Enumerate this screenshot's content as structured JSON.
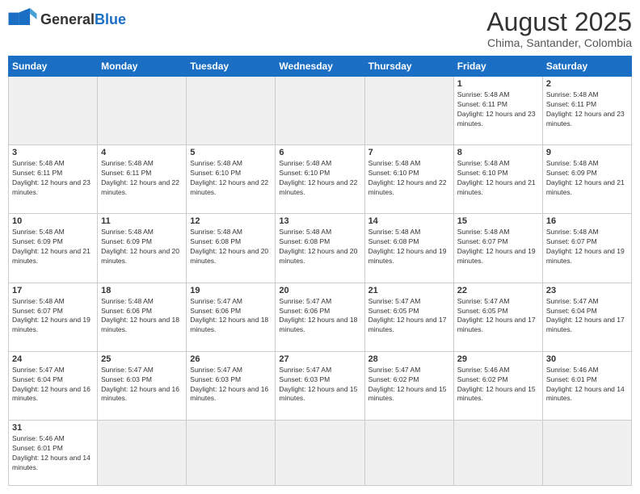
{
  "header": {
    "logo_general": "General",
    "logo_blue": "Blue",
    "month_title": "August 2025",
    "location": "Chima, Santander, Colombia"
  },
  "weekdays": [
    "Sunday",
    "Monday",
    "Tuesday",
    "Wednesday",
    "Thursday",
    "Friday",
    "Saturday"
  ],
  "weeks": [
    [
      {
        "day": "",
        "info": ""
      },
      {
        "day": "",
        "info": ""
      },
      {
        "day": "",
        "info": ""
      },
      {
        "day": "",
        "info": ""
      },
      {
        "day": "",
        "info": ""
      },
      {
        "day": "1",
        "info": "Sunrise: 5:48 AM\nSunset: 6:11 PM\nDaylight: 12 hours and 23 minutes."
      },
      {
        "day": "2",
        "info": "Sunrise: 5:48 AM\nSunset: 6:11 PM\nDaylight: 12 hours and 23 minutes."
      }
    ],
    [
      {
        "day": "3",
        "info": "Sunrise: 5:48 AM\nSunset: 6:11 PM\nDaylight: 12 hours and 23 minutes."
      },
      {
        "day": "4",
        "info": "Sunrise: 5:48 AM\nSunset: 6:11 PM\nDaylight: 12 hours and 22 minutes."
      },
      {
        "day": "5",
        "info": "Sunrise: 5:48 AM\nSunset: 6:10 PM\nDaylight: 12 hours and 22 minutes."
      },
      {
        "day": "6",
        "info": "Sunrise: 5:48 AM\nSunset: 6:10 PM\nDaylight: 12 hours and 22 minutes."
      },
      {
        "day": "7",
        "info": "Sunrise: 5:48 AM\nSunset: 6:10 PM\nDaylight: 12 hours and 22 minutes."
      },
      {
        "day": "8",
        "info": "Sunrise: 5:48 AM\nSunset: 6:10 PM\nDaylight: 12 hours and 21 minutes."
      },
      {
        "day": "9",
        "info": "Sunrise: 5:48 AM\nSunset: 6:09 PM\nDaylight: 12 hours and 21 minutes."
      }
    ],
    [
      {
        "day": "10",
        "info": "Sunrise: 5:48 AM\nSunset: 6:09 PM\nDaylight: 12 hours and 21 minutes."
      },
      {
        "day": "11",
        "info": "Sunrise: 5:48 AM\nSunset: 6:09 PM\nDaylight: 12 hours and 20 minutes."
      },
      {
        "day": "12",
        "info": "Sunrise: 5:48 AM\nSunset: 6:08 PM\nDaylight: 12 hours and 20 minutes."
      },
      {
        "day": "13",
        "info": "Sunrise: 5:48 AM\nSunset: 6:08 PM\nDaylight: 12 hours and 20 minutes."
      },
      {
        "day": "14",
        "info": "Sunrise: 5:48 AM\nSunset: 6:08 PM\nDaylight: 12 hours and 19 minutes."
      },
      {
        "day": "15",
        "info": "Sunrise: 5:48 AM\nSunset: 6:07 PM\nDaylight: 12 hours and 19 minutes."
      },
      {
        "day": "16",
        "info": "Sunrise: 5:48 AM\nSunset: 6:07 PM\nDaylight: 12 hours and 19 minutes."
      }
    ],
    [
      {
        "day": "17",
        "info": "Sunrise: 5:48 AM\nSunset: 6:07 PM\nDaylight: 12 hours and 19 minutes."
      },
      {
        "day": "18",
        "info": "Sunrise: 5:48 AM\nSunset: 6:06 PM\nDaylight: 12 hours and 18 minutes."
      },
      {
        "day": "19",
        "info": "Sunrise: 5:47 AM\nSunset: 6:06 PM\nDaylight: 12 hours and 18 minutes."
      },
      {
        "day": "20",
        "info": "Sunrise: 5:47 AM\nSunset: 6:06 PM\nDaylight: 12 hours and 18 minutes."
      },
      {
        "day": "21",
        "info": "Sunrise: 5:47 AM\nSunset: 6:05 PM\nDaylight: 12 hours and 17 minutes."
      },
      {
        "day": "22",
        "info": "Sunrise: 5:47 AM\nSunset: 6:05 PM\nDaylight: 12 hours and 17 minutes."
      },
      {
        "day": "23",
        "info": "Sunrise: 5:47 AM\nSunset: 6:04 PM\nDaylight: 12 hours and 17 minutes."
      }
    ],
    [
      {
        "day": "24",
        "info": "Sunrise: 5:47 AM\nSunset: 6:04 PM\nDaylight: 12 hours and 16 minutes."
      },
      {
        "day": "25",
        "info": "Sunrise: 5:47 AM\nSunset: 6:03 PM\nDaylight: 12 hours and 16 minutes."
      },
      {
        "day": "26",
        "info": "Sunrise: 5:47 AM\nSunset: 6:03 PM\nDaylight: 12 hours and 16 minutes."
      },
      {
        "day": "27",
        "info": "Sunrise: 5:47 AM\nSunset: 6:03 PM\nDaylight: 12 hours and 15 minutes."
      },
      {
        "day": "28",
        "info": "Sunrise: 5:47 AM\nSunset: 6:02 PM\nDaylight: 12 hours and 15 minutes."
      },
      {
        "day": "29",
        "info": "Sunrise: 5:46 AM\nSunset: 6:02 PM\nDaylight: 12 hours and 15 minutes."
      },
      {
        "day": "30",
        "info": "Sunrise: 5:46 AM\nSunset: 6:01 PM\nDaylight: 12 hours and 14 minutes."
      }
    ],
    [
      {
        "day": "31",
        "info": "Sunrise: 5:46 AM\nSunset: 6:01 PM\nDaylight: 12 hours and 14 minutes."
      },
      {
        "day": "",
        "info": ""
      },
      {
        "day": "",
        "info": ""
      },
      {
        "day": "",
        "info": ""
      },
      {
        "day": "",
        "info": ""
      },
      {
        "day": "",
        "info": ""
      },
      {
        "day": "",
        "info": ""
      }
    ]
  ]
}
